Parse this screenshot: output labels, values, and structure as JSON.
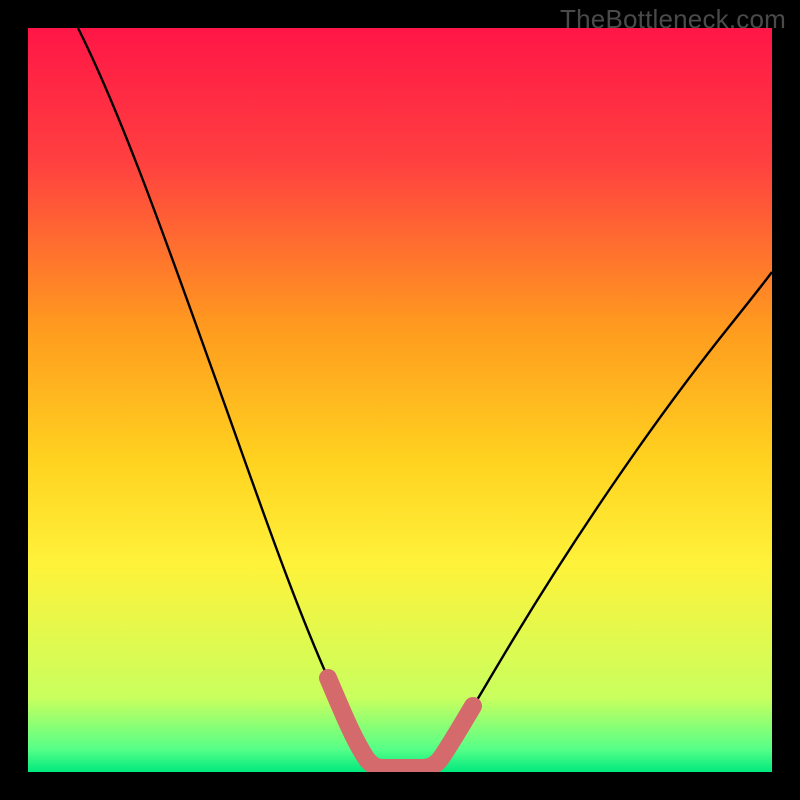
{
  "watermark": "TheBottleneck.com",
  "chart_data": {
    "type": "line",
    "title": "",
    "xlabel": "",
    "ylabel": "",
    "xlim": [
      0,
      100
    ],
    "ylim": [
      0,
      100
    ],
    "background": {
      "type": "vertical-gradient",
      "stops": [
        {
          "pos": 0,
          "color": "#ff1646"
        },
        {
          "pos": 18,
          "color": "#ff4040"
        },
        {
          "pos": 40,
          "color": "#ff9a1f"
        },
        {
          "pos": 58,
          "color": "#ffd21f"
        },
        {
          "pos": 72,
          "color": "#fff23a"
        },
        {
          "pos": 90,
          "color": "#c9ff5e"
        },
        {
          "pos": 97,
          "color": "#55ff88"
        },
        {
          "pos": 100,
          "color": "#00e97e"
        }
      ]
    },
    "series": [
      {
        "name": "bottleneck-curve",
        "color": "#000000",
        "x": [
          0,
          8,
          16,
          24,
          32,
          38,
          41,
          44,
          47,
          50,
          53,
          56,
          60,
          66,
          74,
          84,
          94,
          100
        ],
        "values": [
          100,
          80,
          62,
          45,
          28,
          14,
          7,
          2,
          0,
          0,
          0,
          2,
          7,
          16,
          30,
          48,
          64,
          74
        ]
      },
      {
        "name": "highlight-band",
        "color": "#d86a6a",
        "x": [
          41,
          44,
          47,
          50,
          53,
          56
        ],
        "values": [
          7,
          2,
          0,
          0,
          0,
          2
        ]
      }
    ]
  }
}
